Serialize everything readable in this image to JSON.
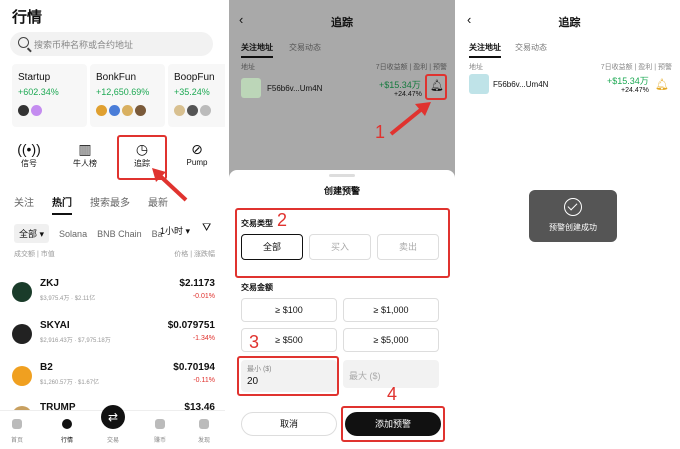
{
  "market": {
    "title": "行情",
    "search_placeholder": "搜索币种名称或合约地址",
    "cards": [
      {
        "name": "Startup",
        "change": "+602.34%"
      },
      {
        "name": "BonkFun",
        "change": "+12,650.69%"
      },
      {
        "name": "BoopFun",
        "change": "+35.24%"
      }
    ],
    "quick": [
      {
        "label": "信号",
        "icon": "signal-icon"
      },
      {
        "label": "牛人榜",
        "icon": "leaderboard-icon"
      },
      {
        "label": "追踪",
        "icon": "tracking-icon"
      },
      {
        "label": "Pump",
        "icon": "pump-icon"
      }
    ],
    "tabs": [
      "关注",
      "热门",
      "搜索最多",
      "最新"
    ],
    "chains": [
      "全部",
      "Solana",
      "BNB Chain",
      "Ba"
    ],
    "timeframe": "1小时",
    "col_left": "成交额 | 市值",
    "col_right": "价格 | 涨跌幅",
    "rows": [
      {
        "sym": "ZKJ",
        "sub": "$3,975.4万 · $2.11亿",
        "price": "$2.1173",
        "chg": "-0.01%"
      },
      {
        "sym": "SKYAI",
        "sub": "$2,916.43万 · $7,975.18万",
        "price": "$0.079751",
        "chg": "-1.34%"
      },
      {
        "sym": "B2",
        "sub": "$1,260.57万 · $1.67亿",
        "price": "$0.70194",
        "chg": "-0.11%"
      },
      {
        "sym": "TRUMP",
        "sub": "",
        "price": "$13.46",
        "chg": ""
      }
    ],
    "tabbar": [
      "首页",
      "行情",
      "交易",
      "赚币",
      "发现"
    ]
  },
  "track": {
    "title": "追踪",
    "tabs": [
      "关注地址",
      "交易动态"
    ],
    "col_address": "地址",
    "col_stats": "7日收益额 | 盈利 | 预警",
    "address": "F56b6v...Um4N",
    "pnl": "+$15.34万",
    "pnl_pct": "+24.47%"
  },
  "alert": {
    "title": "创建预警",
    "type_label": "交易类型",
    "types": [
      "全部",
      "买入",
      "卖出"
    ],
    "amount_label": "交易金额",
    "amounts": [
      "≥ $100",
      "≥ $1,000",
      "≥ $500",
      "≥ $5,000"
    ],
    "min_label": "最小 ($)",
    "min_value": "20",
    "max_placeholder": "最大 ($)",
    "cancel": "取消",
    "submit": "添加预警"
  },
  "annotations": [
    "1",
    "2",
    "3",
    "4"
  ],
  "toast": "预警创建成功"
}
